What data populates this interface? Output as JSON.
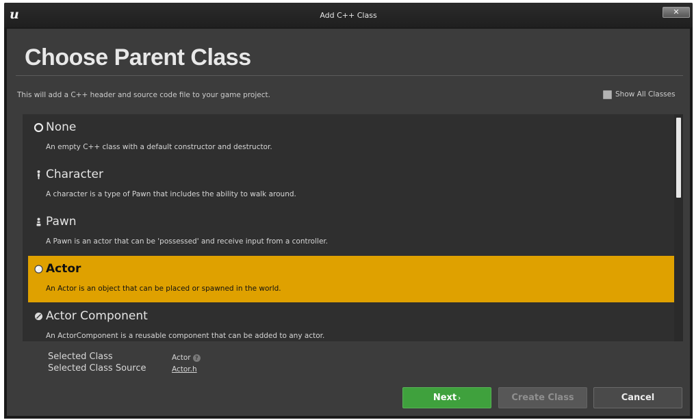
{
  "window": {
    "title": "Add C++ Class",
    "logo_text": "u",
    "close_label": "✕"
  },
  "heading": "Choose Parent Class",
  "subtitle": "This will add a C++ header and source code file to your game project.",
  "show_all_classes": {
    "label": "Show All Classes",
    "checked": false
  },
  "classes": [
    {
      "title": "None",
      "description": "An empty C++ class with a default constructor and destructor.",
      "icon": "none-radio-icon",
      "selected": false
    },
    {
      "title": "Character",
      "description": "A character is a type of Pawn that includes the ability to walk around.",
      "icon": "character-icon",
      "selected": false
    },
    {
      "title": "Pawn",
      "description": "A Pawn is an actor that can be 'possessed' and receive input from a controller.",
      "icon": "pawn-icon",
      "selected": false
    },
    {
      "title": "Actor",
      "description": "An Actor is an object that can be placed or spawned in the world.",
      "icon": "actor-icon",
      "selected": true
    },
    {
      "title": "Actor Component",
      "description": "An ActorComponent is a reusable component that can be added to any actor.",
      "icon": "actor-component-icon",
      "selected": false
    }
  ],
  "selected_class": {
    "label": "Selected Class",
    "value": "Actor",
    "help_icon": "?"
  },
  "selected_class_source": {
    "label": "Selected Class Source",
    "value": "Actor.h"
  },
  "buttons": {
    "next": "Next",
    "next_chevron": "›",
    "create": "Create Class",
    "cancel": "Cancel"
  },
  "colors": {
    "selection": "#dfa100",
    "next_button": "#3fa13d",
    "panel": "#3c3c3c"
  }
}
